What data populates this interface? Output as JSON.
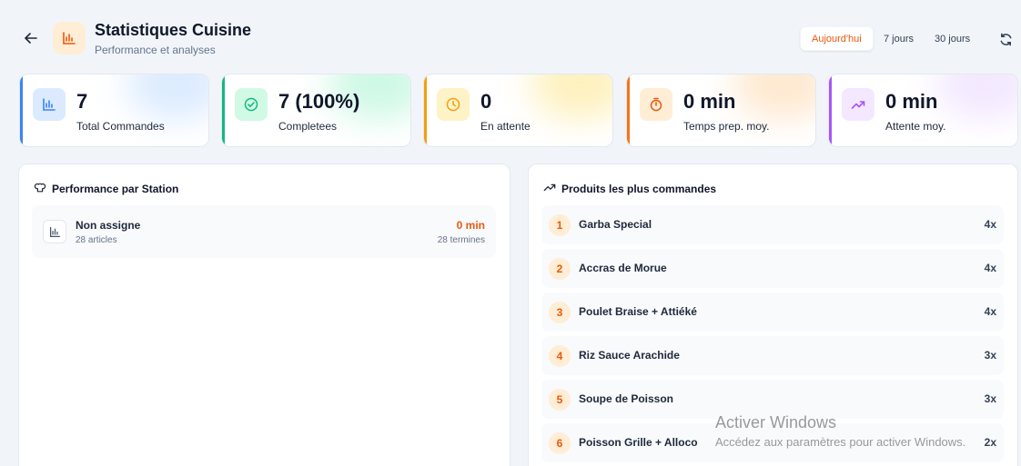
{
  "header": {
    "title": "Statistiques Cuisine",
    "subtitle": "Performance et analyses",
    "ranges": [
      "Aujourd'hui",
      "7 jours",
      "30 jours"
    ],
    "active_range": "Aujourd'hui"
  },
  "stats": [
    {
      "value": "7",
      "label": "Total Commandes",
      "color": "#3b82f6",
      "icon": "bar-chart-icon"
    },
    {
      "value": "7 (100%)",
      "label": "Completees",
      "color": "#10b981",
      "icon": "check-circle-icon"
    },
    {
      "value": "0",
      "label": "En attente",
      "color": "#f59e0b",
      "icon": "clock-icon"
    },
    {
      "value": "0 min",
      "label": "Temps prep. moy.",
      "color": "#f97316",
      "icon": "timer-icon"
    },
    {
      "value": "0 min",
      "label": "Attente moy.",
      "color": "#a855f7",
      "icon": "trend-up-icon"
    }
  ],
  "station_panel": {
    "title": "Performance par Station",
    "stations": [
      {
        "name": "Non assigne",
        "articles": "28 articles",
        "time": "0 min",
        "done": "28 termines"
      }
    ]
  },
  "products_panel": {
    "title": "Produits les plus commandes",
    "items": [
      {
        "rank": "1",
        "name": "Garba Special",
        "count": "4x"
      },
      {
        "rank": "2",
        "name": "Accras de Morue",
        "count": "4x"
      },
      {
        "rank": "3",
        "name": "Poulet Braise + Attiéké",
        "count": "4x"
      },
      {
        "rank": "4",
        "name": "Riz Sauce Arachide",
        "count": "3x"
      },
      {
        "rank": "5",
        "name": "Soupe de Poisson",
        "count": "3x"
      },
      {
        "rank": "6",
        "name": "Poisson Grille + Alloco",
        "count": "2x"
      }
    ]
  },
  "watermark": {
    "line1": "Activer Windows",
    "line2": "Accédez aux paramètres pour activer Windows."
  }
}
